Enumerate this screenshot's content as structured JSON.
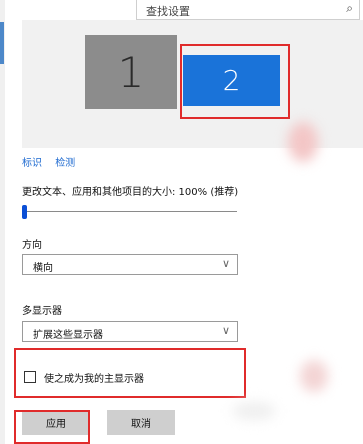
{
  "search": {
    "placeholder": "查找设置",
    "icon": "search-icon"
  },
  "display": {
    "monitors": [
      {
        "number": "1",
        "color": "#8c8c8c"
      },
      {
        "number": "2",
        "color": "#1a73d9",
        "selected": true
      }
    ],
    "identify_link": "标识",
    "detect_link": "检测"
  },
  "scale": {
    "label": "更改文本、应用和其他项目的大小: 100% (推荐)",
    "slider_value_fraction": 0.0
  },
  "orientation": {
    "label": "方向",
    "value": "横向"
  },
  "multiple_displays": {
    "label": "多显示器",
    "value": "扩展这些显示器"
  },
  "main_display": {
    "label": "使之成为我的主显示器",
    "checked": false
  },
  "buttons": {
    "apply": "应用",
    "cancel": "取消"
  },
  "colors": {
    "accent": "#1a73d9",
    "link": "#1e6ad0",
    "highlight": "#e02b2b"
  }
}
